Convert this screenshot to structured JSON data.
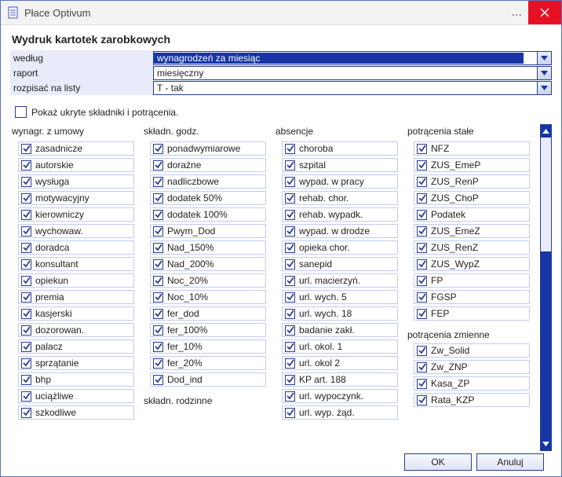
{
  "window": {
    "title": "Płace Optivum"
  },
  "header": {
    "heading": "Wydruk kartotek zarobkowych",
    "fields": {
      "field1_label": "według",
      "field1_value": "wynagrodzeń za miesiąc",
      "field2_label": "raport",
      "field2_value": "miesięczny",
      "field3_label": "rozpisać na listy",
      "field3_value": "T - tak"
    }
  },
  "option_show_hidden": "Pokaż ukryte składniki i potrącenia.",
  "columns": {
    "col1": {
      "title": "wynagr. z umowy",
      "items": [
        "zasadnicze",
        "autorskie",
        "wysługa",
        "motywacyjny",
        "kierowniczy",
        "wychowaw.",
        "doradca",
        "konsultant",
        "opiekun",
        "premia",
        "kasjerski",
        "dozorowan.",
        "palacz",
        "sprzątanie",
        "bhp",
        "uciążliwe",
        "szkodliwe"
      ]
    },
    "col2": {
      "title": "składn. godz.",
      "items": [
        "ponadwymiarowe",
        "doraźne",
        "nadliczbowe",
        "dodatek 50%",
        "dodatek 100%",
        "Pwym_Dod",
        "Nad_150%",
        "Nad_200%",
        "Noc_20%",
        "Noc_10%",
        "fer_dod",
        "fer_100%",
        "fer_10%",
        "fer_20%",
        "Dod_ind"
      ],
      "subtitle": "składn. rodzinne"
    },
    "col3": {
      "title": "absencje",
      "items": [
        "choroba",
        "szpital",
        "wypad. w pracy",
        "rehab. chor.",
        "rehab. wypadk.",
        "wypad. w drodze",
        "opieka chor.",
        "sanepid",
        "url. macierzyń.",
        "url. wych. 5",
        "url. wych. 18",
        "badanie zakł.",
        "url. okol. 1",
        "url. okol 2",
        "KP art. 188",
        "url. wypoczynk.",
        "url. wyp. żąd."
      ]
    },
    "col4a": {
      "title": "potrącenia stałe",
      "items": [
        "NFZ",
        "ZUS_EmeP",
        "ZUS_RenP",
        "ZUS_ChoP",
        "Podatek",
        "ZUS_EmeZ",
        "ZUS_RenZ",
        "ZUS_WypZ",
        "FP",
        "FGSP",
        "FEP"
      ]
    },
    "col4b": {
      "title": "potrącenia zmienne",
      "items": [
        "Zw_Solid",
        "Zw_ZNP",
        "Kasa_ZP",
        "Rata_KZP"
      ]
    }
  },
  "footer": {
    "ok": "OK",
    "cancel": "Anuluj"
  }
}
